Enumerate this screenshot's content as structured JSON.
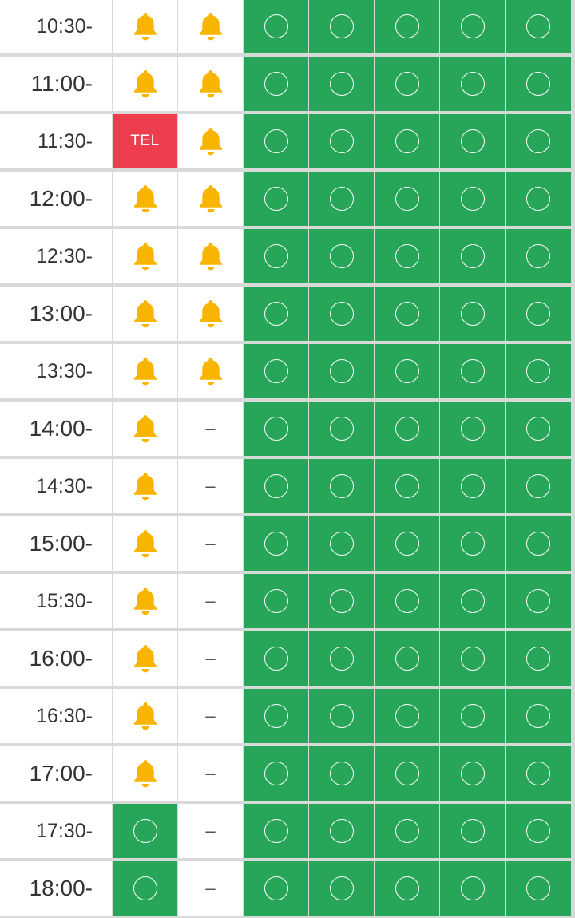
{
  "colors": {
    "available": "#27a65a",
    "tel": "#ee3d4d",
    "bell": "#f7b500",
    "row_divider": "#d9d9d9"
  },
  "legend_icons": {
    "bell": "bell-icon",
    "available": "circle-icon",
    "unavailable": "dash-icon",
    "phone_only": "TEL"
  },
  "rows": [
    {
      "time": "10:30-",
      "cells": [
        "bell",
        "bell",
        "circle",
        "circle",
        "circle",
        "circle",
        "circle"
      ]
    },
    {
      "time": "11:00-",
      "cells": [
        "bell",
        "bell",
        "circle",
        "circle",
        "circle",
        "circle",
        "circle"
      ]
    },
    {
      "time": "11:30-",
      "cells": [
        "tel",
        "bell",
        "circle",
        "circle",
        "circle",
        "circle",
        "circle"
      ]
    },
    {
      "time": "12:00-",
      "cells": [
        "bell",
        "bell",
        "circle",
        "circle",
        "circle",
        "circle",
        "circle"
      ]
    },
    {
      "time": "12:30-",
      "cells": [
        "bell",
        "bell",
        "circle",
        "circle",
        "circle",
        "circle",
        "circle"
      ]
    },
    {
      "time": "13:00-",
      "cells": [
        "bell",
        "bell",
        "circle",
        "circle",
        "circle",
        "circle",
        "circle"
      ]
    },
    {
      "time": "13:30-",
      "cells": [
        "bell",
        "bell",
        "circle",
        "circle",
        "circle",
        "circle",
        "circle"
      ]
    },
    {
      "time": "14:00-",
      "cells": [
        "bell",
        "dash",
        "circle",
        "circle",
        "circle",
        "circle",
        "circle"
      ]
    },
    {
      "time": "14:30-",
      "cells": [
        "bell",
        "dash",
        "circle",
        "circle",
        "circle",
        "circle",
        "circle"
      ]
    },
    {
      "time": "15:00-",
      "cells": [
        "bell",
        "dash",
        "circle",
        "circle",
        "circle",
        "circle",
        "circle"
      ]
    },
    {
      "time": "15:30-",
      "cells": [
        "bell",
        "dash",
        "circle",
        "circle",
        "circle",
        "circle",
        "circle"
      ]
    },
    {
      "time": "16:00-",
      "cells": [
        "bell",
        "dash",
        "circle",
        "circle",
        "circle",
        "circle",
        "circle"
      ]
    },
    {
      "time": "16:30-",
      "cells": [
        "bell",
        "dash",
        "circle",
        "circle",
        "circle",
        "circle",
        "circle"
      ]
    },
    {
      "time": "17:00-",
      "cells": [
        "bell",
        "dash",
        "circle",
        "circle",
        "circle",
        "circle",
        "circle"
      ]
    },
    {
      "time": "17:30-",
      "cells": [
        "circle",
        "dash",
        "circle",
        "circle",
        "circle",
        "circle",
        "circle"
      ]
    },
    {
      "time": "18:00-",
      "cells": [
        "circle",
        "dash",
        "circle",
        "circle",
        "circle",
        "circle",
        "circle"
      ]
    }
  ],
  "tel_label": "TEL",
  "dash_label": "–"
}
